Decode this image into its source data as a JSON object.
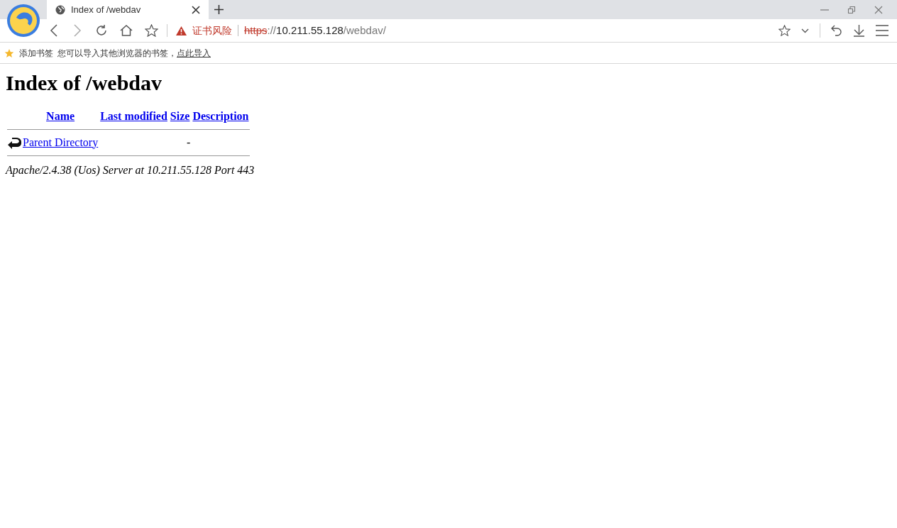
{
  "tab": {
    "title": "Index of /webdav",
    "selected": true
  },
  "address_bar": {
    "security_warning": "证书风险",
    "url_parts": [
      {
        "kind": "scheme",
        "text": "https"
      },
      {
        "kind": "sep",
        "text": "://"
      },
      {
        "kind": "host",
        "text": "10.211.55.128"
      },
      {
        "kind": "path",
        "text": "/webdav/"
      }
    ]
  },
  "bookmarks_bar": {
    "label": "添加书签",
    "hint": "您可以导入其他浏览器的书签，",
    "link": "点此导入"
  },
  "page": {
    "heading": "Index of /webdav",
    "columns": [
      "Name",
      "Last modified",
      "Size",
      "Description"
    ],
    "rows": [
      {
        "kind": "parent",
        "name": "Parent Directory",
        "last_modified": "",
        "size": "-",
        "description": ""
      }
    ],
    "footer": "Apache/2.4.38 (Uos) Server at 10.211.55.128 Port 443"
  }
}
